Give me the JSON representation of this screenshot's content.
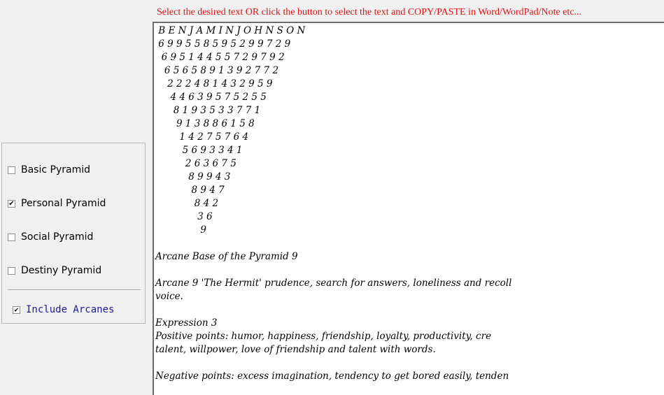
{
  "instruction": "Select the desired text OR click the button to select the text and COPY/PASTE in Word/WordPad/Note etc...",
  "options": {
    "basic": {
      "label": "Basic Pyramid",
      "checked": false
    },
    "personal": {
      "label": "Personal Pyramid",
      "checked": true
    },
    "social": {
      "label": "Social Pyramid",
      "checked": false
    },
    "destiny": {
      "label": "Destiny Pyramid",
      "checked": false
    },
    "arcanes": {
      "label": "Include Arcanes",
      "checked": true
    }
  },
  "output_text": [
    " B E N J A M I N J O H N S O N",
    " 6 9 9 5 5 8 5 9 5 2 9 9 7 2 9",
    "  6 9 5 1 4 4 5 5 7 2 9 7 9 2",
    "   6 5 6 5 8 9 1 3 9 2 7 7 2",
    "    2 2 2 4 8 1 4 3 2 9 5 9",
    "     4 4 6 3 9 5 7 5 2 5 5",
    "      8 1 9 3 5 3 3 7 7 1",
    "       9 1 3 8 8 6 1 5 8",
    "        1 4 2 7 5 7 6 4",
    "         5 6 9 3 3 4 1",
    "          2 6 3 6 7 5",
    "           8 9 9 4 3",
    "            8 9 4 7",
    "             8 4 2",
    "              3 6",
    "               9",
    "",
    "Arcane Base of the Pyramid 9",
    "",
    "Arcane 9 'The Hermit' prudence, search for answers, loneliness and recoll",
    "voice.",
    "",
    "Expression 3",
    "Positive points: humor, happiness, friendship, loyalty, productivity, cre",
    "talent, willpower, love of friendship and talent with words.",
    "",
    "Negative points: excess imagination, tendency to get bored easily, tenden"
  ]
}
